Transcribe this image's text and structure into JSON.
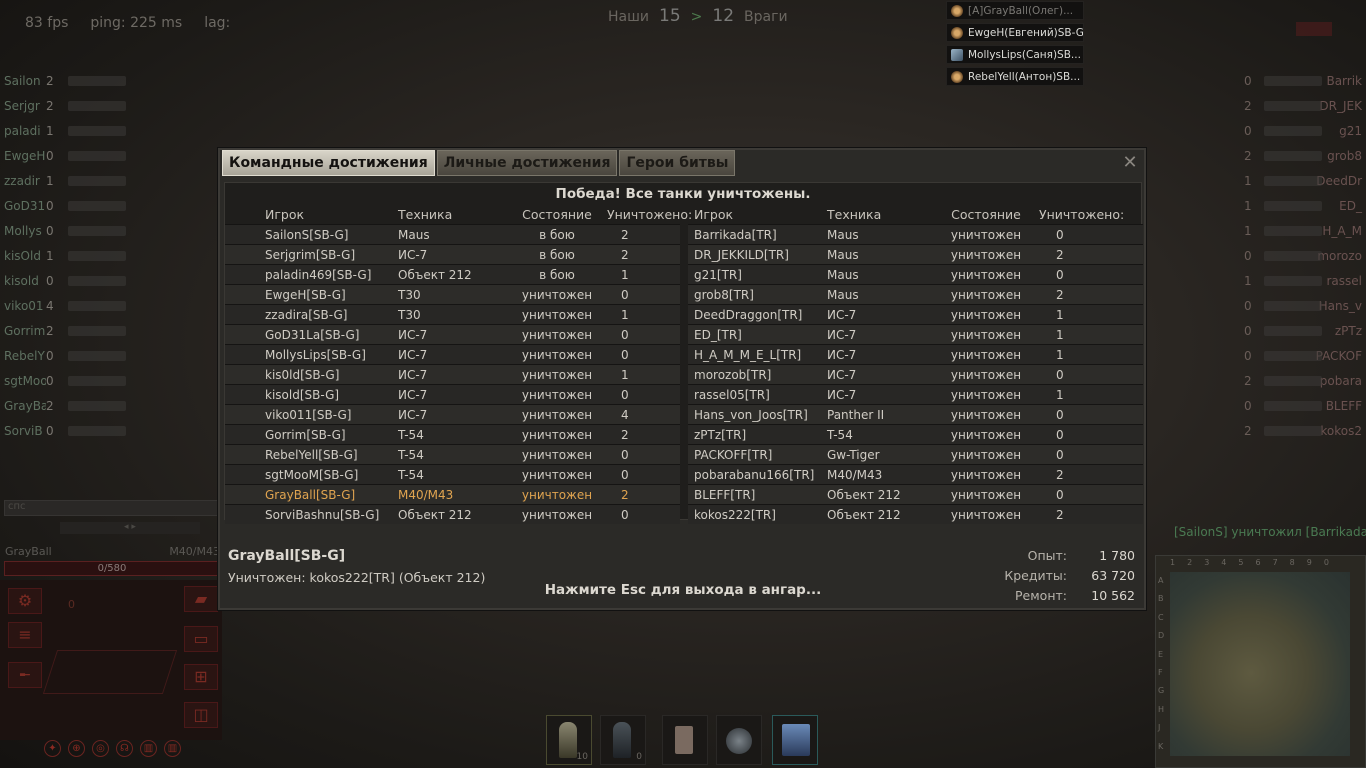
{
  "hud": {
    "fps": "83 fps",
    "ping": "ping: 225 ms",
    "lag": "lag:",
    "ours_label": "Наши",
    "ours_score": "15",
    "separator": ">",
    "theirs_score": "12",
    "theirs_label": "Враги"
  },
  "notifications": [
    {
      "text": "[A]GrayBall(Олег)...",
      "icon": "medal-icon",
      "dim": true
    },
    {
      "text": "EwgeH(Евгений)SB-G",
      "icon": "medal-icon",
      "dim": false
    },
    {
      "text": "MollysLips(Саня)SB...",
      "icon": "portrait-icon",
      "dim": false
    },
    {
      "text": "RebelYell(Антон)SB...",
      "icon": "medal-icon",
      "dim": false
    }
  ],
  "team_left": [
    {
      "name": "Sailon",
      "frags": "2"
    },
    {
      "name": "Serjgr",
      "frags": "2"
    },
    {
      "name": "paladi",
      "frags": "1"
    },
    {
      "name": "EwgeH",
      "frags": "0"
    },
    {
      "name": "zzadir",
      "frags": "1"
    },
    {
      "name": "GoD31L",
      "frags": "0"
    },
    {
      "name": "Mollys",
      "frags": "0"
    },
    {
      "name": "kisOld",
      "frags": "1"
    },
    {
      "name": "kisold",
      "frags": "0"
    },
    {
      "name": "viko01",
      "frags": "4"
    },
    {
      "name": "Gorrim",
      "frags": "2"
    },
    {
      "name": "RebelY",
      "frags": "0"
    },
    {
      "name": "sgtMoo",
      "frags": "0"
    },
    {
      "name": "GrayBa",
      "frags": "2"
    },
    {
      "name": "SorviB",
      "frags": "0"
    }
  ],
  "team_right": [
    {
      "name": "Barrik",
      "frags": "0"
    },
    {
      "name": "DR_JEK",
      "frags": "2"
    },
    {
      "name": "g21",
      "frags": "0"
    },
    {
      "name": "grob8",
      "frags": "2"
    },
    {
      "name": "DeedDr",
      "frags": "1"
    },
    {
      "name": "ED_",
      "frags": "1"
    },
    {
      "name": "H_A_M",
      "frags": "1"
    },
    {
      "name": "morozo",
      "frags": "0"
    },
    {
      "name": "rassel",
      "frags": "1"
    },
    {
      "name": "Hans_v",
      "frags": "0"
    },
    {
      "name": "zPTz",
      "frags": "0"
    },
    {
      "name": "PACKOF",
      "frags": "0"
    },
    {
      "name": "pobara",
      "frags": "2"
    },
    {
      "name": "BLEFF",
      "frags": "0"
    },
    {
      "name": "kokos2",
      "frags": "2"
    }
  ],
  "damage_panel": {
    "player": "GrayBall",
    "tank": "M40/M43",
    "hp": "0/580",
    "chat_placeholder": "cпс",
    "speed": "0"
  },
  "ammo": [
    {
      "count": "10"
    },
    {
      "count": "0"
    },
    {
      "count": ""
    },
    {
      "count": ""
    },
    {
      "count": ""
    }
  ],
  "kill_message": "[SailonS] уничтожил [Barrikada]",
  "minimap": {
    "letters": [
      "A",
      "B",
      "C",
      "D",
      "E",
      "F",
      "G",
      "H",
      "J",
      "K"
    ],
    "numbers": [
      "1",
      "2",
      "3",
      "4",
      "5",
      "6",
      "7",
      "8",
      "9",
      "0"
    ]
  },
  "dialog": {
    "tabs": [
      "Командные достижения",
      "Личные достижения",
      "Герои битвы"
    ],
    "result": "Победа! Все танки уничтожены.",
    "headers": {
      "player": "Игрок",
      "tank": "Техника",
      "state": "Состояние",
      "kills": "Уничтожено:"
    },
    "allies": [
      {
        "player": "SailonS[SB-G]",
        "tank": "Maus",
        "state": "в бою",
        "kills": "2"
      },
      {
        "player": "Serjgrim[SB-G]",
        "tank": "ИС-7",
        "state": "в бою",
        "kills": "2"
      },
      {
        "player": "paladin469[SB-G]",
        "tank": "Объект 212",
        "state": "в бою",
        "kills": "1"
      },
      {
        "player": "EwgeH[SB-G]",
        "tank": "T30",
        "state": "уничтожен",
        "kills": "0"
      },
      {
        "player": "zzadira[SB-G]",
        "tank": "T30",
        "state": "уничтожен",
        "kills": "1"
      },
      {
        "player": "GoD31La[SB-G]",
        "tank": "ИС-7",
        "state": "уничтожен",
        "kills": "0"
      },
      {
        "player": "MollysLips[SB-G]",
        "tank": "ИС-7",
        "state": "уничтожен",
        "kills": "0"
      },
      {
        "player": "kis0ld[SB-G]",
        "tank": "ИС-7",
        "state": "уничтожен",
        "kills": "1"
      },
      {
        "player": "kisold[SB-G]",
        "tank": "ИС-7",
        "state": "уничтожен",
        "kills": "0"
      },
      {
        "player": "viko011[SB-G]",
        "tank": "ИС-7",
        "state": "уничтожен",
        "kills": "4"
      },
      {
        "player": "Gorrim[SB-G]",
        "tank": "T-54",
        "state": "уничтожен",
        "kills": "2"
      },
      {
        "player": "RebelYell[SB-G]",
        "tank": "T-54",
        "state": "уничтожен",
        "kills": "0"
      },
      {
        "player": "sgtMooM[SB-G]",
        "tank": "T-54",
        "state": "уничтожен",
        "kills": "0"
      },
      {
        "player": "GrayBall[SB-G]",
        "tank": "M40/M43",
        "state": "уничтожен",
        "kills": "2",
        "highlight": true
      },
      {
        "player": "SorviBashnu[SB-G]",
        "tank": "Объект 212",
        "state": "уничтожен",
        "kills": "0"
      }
    ],
    "enemies": [
      {
        "player": "Barrikada[TR]",
        "tank": "Maus",
        "state": "уничтожен",
        "kills": "0"
      },
      {
        "player": "DR_JEKKILD[TR]",
        "tank": "Maus",
        "state": "уничтожен",
        "kills": "2"
      },
      {
        "player": "g21[TR]",
        "tank": "Maus",
        "state": "уничтожен",
        "kills": "0"
      },
      {
        "player": "grob8[TR]",
        "tank": "Maus",
        "state": "уничтожен",
        "kills": "2"
      },
      {
        "player": "DeedDraggon[TR]",
        "tank": "ИС-7",
        "state": "уничтожен",
        "kills": "1"
      },
      {
        "player": "ED_[TR]",
        "tank": "ИС-7",
        "state": "уничтожен",
        "kills": "1"
      },
      {
        "player": "H_A_M_M_E_L[TR]",
        "tank": "ИС-7",
        "state": "уничтожен",
        "kills": "1"
      },
      {
        "player": "morozob[TR]",
        "tank": "ИС-7",
        "state": "уничтожен",
        "kills": "0"
      },
      {
        "player": "rassel05[TR]",
        "tank": "ИС-7",
        "state": "уничтожен",
        "kills": "1"
      },
      {
        "player": "Hans_von_Joos[TR]",
        "tank": "Panther II",
        "state": "уничтожен",
        "kills": "0"
      },
      {
        "player": "zPTz[TR]",
        "tank": "T-54",
        "state": "уничтожен",
        "kills": "0"
      },
      {
        "player": "PACKOFF[TR]",
        "tank": "Gw-Tiger",
        "state": "уничтожен",
        "kills": "0"
      },
      {
        "player": "pobarabanu166[TR]",
        "tank": "M40/M43",
        "state": "уничтожен",
        "kills": "2"
      },
      {
        "player": "BLEFF[TR]",
        "tank": "Объект 212",
        "state": "уничтожен",
        "kills": "0"
      },
      {
        "player": "kokos222[TR]",
        "tank": "Объект 212",
        "state": "уничтожен",
        "kills": "2"
      }
    ],
    "footer": {
      "player": "GrayBall[SB-G]",
      "killed_by": "Уничтожен: kokos222[TR] (Объект 212)",
      "hint": "Нажмите Esc для выхода в ангар...",
      "stats": [
        {
          "label": "Опыт:",
          "value": "1 780"
        },
        {
          "label": "Кредиты:",
          "value": "63 720"
        },
        {
          "label": "Ремонт:",
          "value": "10 562"
        }
      ]
    }
  }
}
